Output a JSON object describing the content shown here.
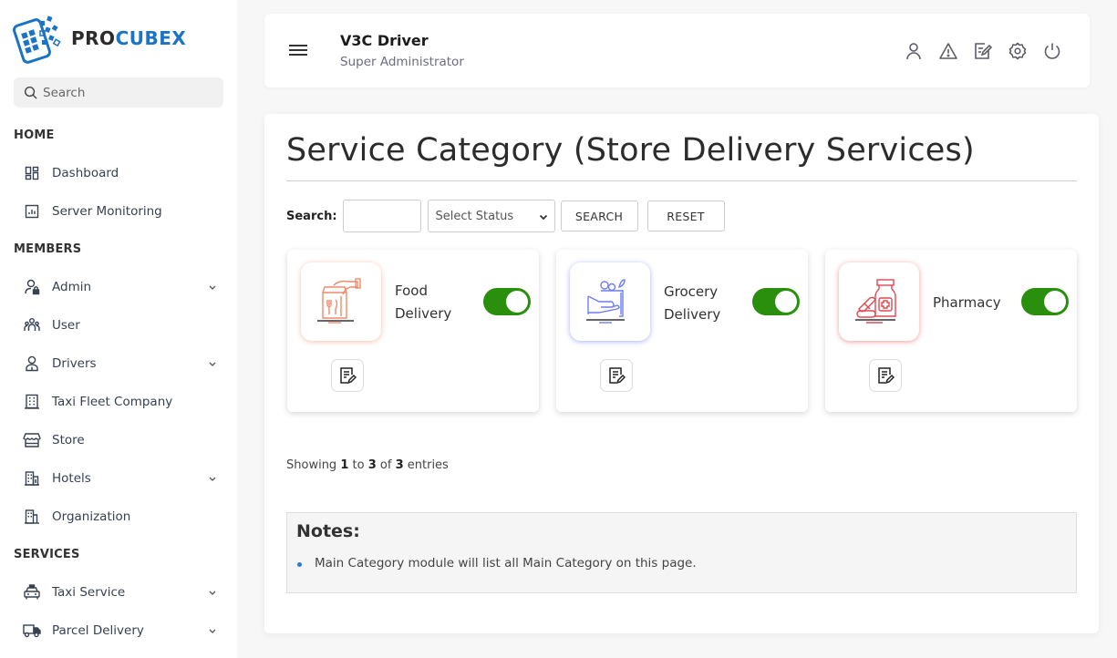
{
  "brand": {
    "part1": "PRO",
    "part2": "CUBEX",
    "primary_color": "#1a73c4"
  },
  "sidebar": {
    "search_placeholder": "Search",
    "sections": [
      {
        "title": "HOME",
        "items": [
          {
            "label": "Dashboard",
            "icon": "dashboard-grid-icon",
            "has_children": false
          },
          {
            "label": "Server Monitoring",
            "icon": "chart-monitor-icon",
            "has_children": false
          }
        ]
      },
      {
        "title": "MEMBERS",
        "items": [
          {
            "label": "Admin",
            "icon": "admin-lock-icon",
            "has_children": true
          },
          {
            "label": "User",
            "icon": "users-group-icon",
            "has_children": false
          },
          {
            "label": "Drivers",
            "icon": "driver-icon",
            "has_children": true
          },
          {
            "label": "Taxi Fleet Company",
            "icon": "building-icon",
            "has_children": false
          },
          {
            "label": "Store",
            "icon": "store-icon",
            "has_children": false
          },
          {
            "label": "Hotels",
            "icon": "hotel-icon",
            "has_children": true
          },
          {
            "label": "Organization",
            "icon": "organization-icon",
            "has_children": false
          }
        ]
      },
      {
        "title": "SERVICES",
        "items": [
          {
            "label": "Taxi Service",
            "icon": "taxi-icon",
            "has_children": true
          },
          {
            "label": "Parcel Delivery",
            "icon": "truck-icon",
            "has_children": true
          }
        ]
      }
    ]
  },
  "header": {
    "user_name": "V3C Driver",
    "user_role": "Super Administrator",
    "icons": [
      "profile-icon",
      "alert-icon",
      "edit-note-icon",
      "settings-icon",
      "power-icon"
    ]
  },
  "page": {
    "title": "Service Category (Store Delivery Services)",
    "filter": {
      "search_label": "Search:",
      "search_value": "",
      "status_placeholder": "Select Status",
      "search_button": "SEARCH",
      "reset_button": "RESET"
    },
    "categories": [
      {
        "name_line1": "Food",
        "name_line2": "Delivery",
        "enabled": true,
        "accent": "#f08a6a"
      },
      {
        "name_line1": "Grocery",
        "name_line2": "Delivery",
        "enabled": true,
        "accent": "#6f7ff0"
      },
      {
        "name_line1": "Pharmacy",
        "name_line2": "",
        "enabled": true,
        "accent": "#e0484f"
      }
    ],
    "toggle_on_color": "#2a8f0c",
    "showing": {
      "prefix": "Showing",
      "from": "1",
      "to_word": "to",
      "to": "3",
      "of_word": "of",
      "total": "3",
      "suffix": "entries"
    },
    "notes": {
      "title": "Notes:",
      "items": [
        "Main Category module will list all Main Category on this page."
      ]
    }
  }
}
